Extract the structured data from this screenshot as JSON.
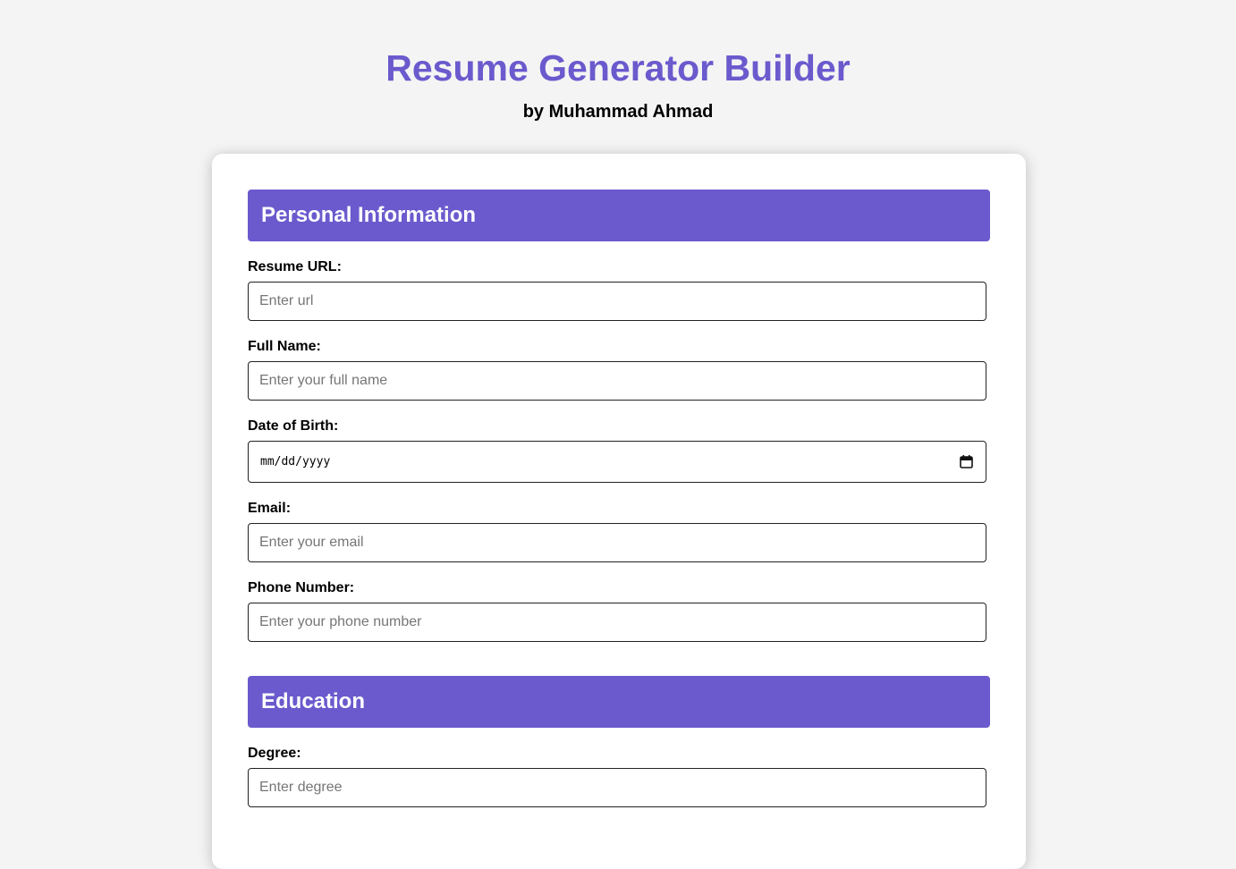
{
  "header": {
    "title": "Resume Generator Builder",
    "byline": "by Muhammad Ahmad"
  },
  "colors": {
    "accent": "#6a5acd",
    "background": "#f4f4f4",
    "card": "#ffffff"
  },
  "personal": {
    "heading": "Personal Information",
    "resume_url": {
      "label": "Resume URL:",
      "placeholder": "Enter url",
      "value": ""
    },
    "full_name": {
      "label": "Full Name:",
      "placeholder": "Enter your full name",
      "value": ""
    },
    "dob": {
      "label": "Date of Birth:",
      "display": "mm/dd/yyyy",
      "icon": "calendar-icon"
    },
    "email": {
      "label": "Email:",
      "placeholder": "Enter your email",
      "value": ""
    },
    "phone": {
      "label": "Phone Number:",
      "placeholder": "Enter your phone number",
      "value": ""
    }
  },
  "education": {
    "heading": "Education",
    "degree": {
      "label": "Degree:",
      "placeholder": "Enter degree",
      "value": ""
    }
  }
}
